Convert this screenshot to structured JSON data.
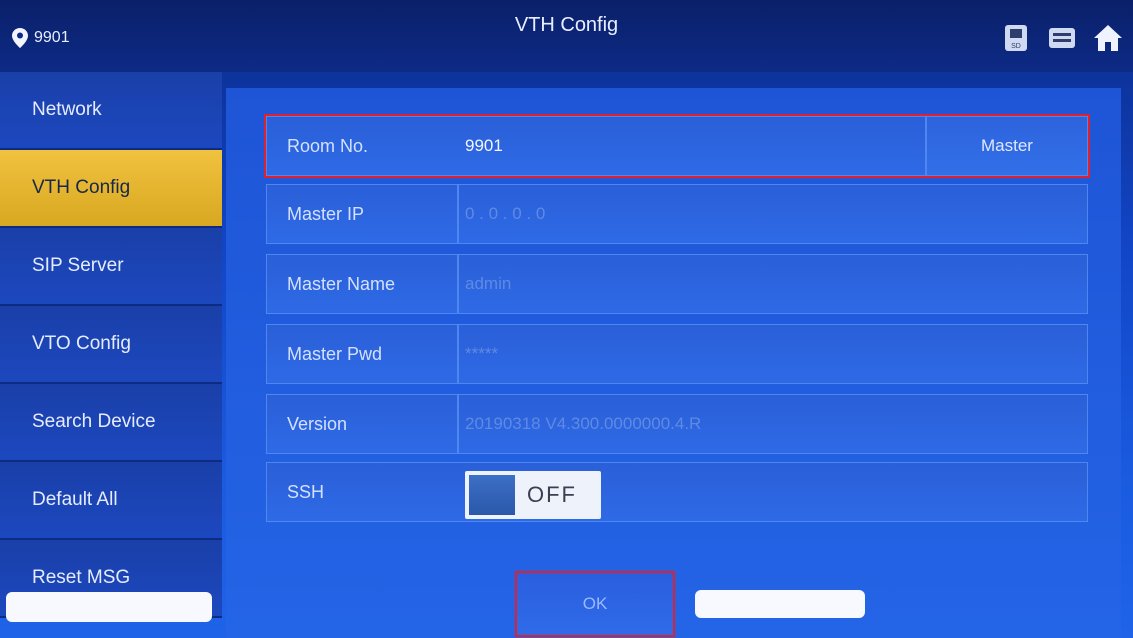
{
  "header": {
    "location": "9901",
    "title": "VTH Config"
  },
  "sidebar": {
    "items": [
      {
        "label": "Network"
      },
      {
        "label": "VTH Config"
      },
      {
        "label": "SIP Server"
      },
      {
        "label": "VTO Config"
      },
      {
        "label": "Search Device"
      },
      {
        "label": "Default All"
      },
      {
        "label": "Reset MSG"
      }
    ],
    "active_index": 1
  },
  "form": {
    "room_no": {
      "label": "Room No.",
      "value": "9901",
      "role_button": "Master"
    },
    "master_ip": {
      "label": "Master IP",
      "value": "0 . 0 . 0 . 0"
    },
    "master_name": {
      "label": "Master Name",
      "value": "admin"
    },
    "master_pwd": {
      "label": "Master Pwd",
      "value": "*****"
    },
    "version": {
      "label": "Version",
      "value": "20190318 V4.300.0000000.4.R"
    },
    "ssh": {
      "label": "SSH",
      "state": "OFF"
    }
  },
  "ok_label": "OK",
  "colors": {
    "active_tab": "#f1c23f",
    "highlight": "#e0212b",
    "background": "#1a5be0"
  },
  "icons": [
    "location-pin-icon",
    "sd-card-icon",
    "storage-icon",
    "home-icon"
  ]
}
